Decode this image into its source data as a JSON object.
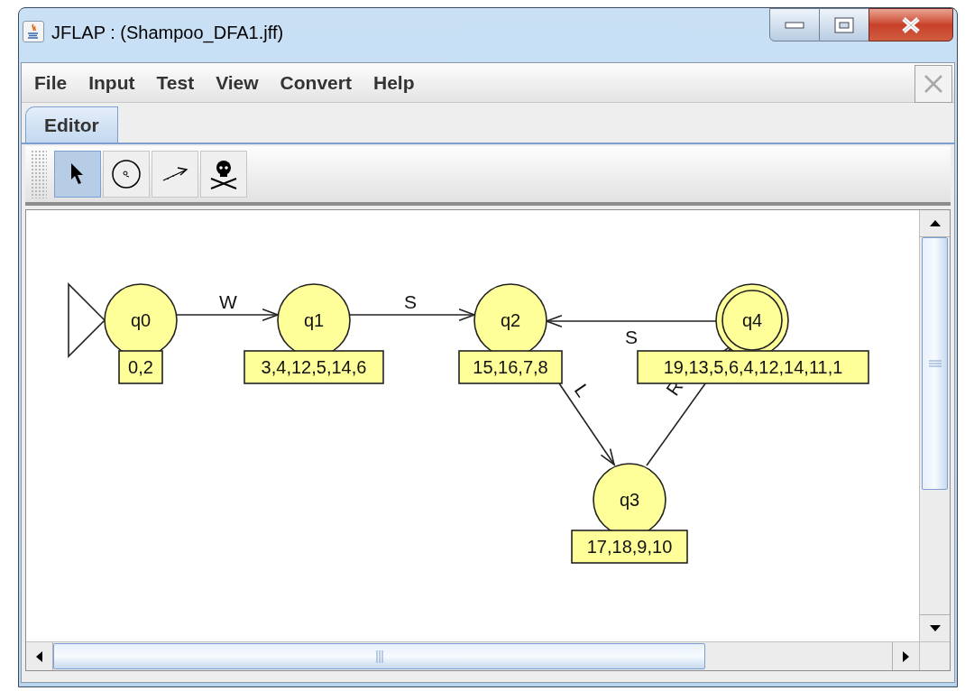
{
  "window": {
    "title": "JFLAP : (Shampoo_DFA1.jff)"
  },
  "menu": [
    "File",
    "Input",
    "Test",
    "View",
    "Convert",
    "Help"
  ],
  "tabs": [
    {
      "label": "Editor",
      "selected": true
    }
  ],
  "tools": [
    {
      "kind": "select",
      "selected": true
    },
    {
      "kind": "state",
      "selected": false
    },
    {
      "kind": "transition",
      "selected": false
    },
    {
      "kind": "delete",
      "selected": false
    }
  ],
  "states": [
    {
      "name": "q0",
      "note": "0,2",
      "initial": true,
      "final": false
    },
    {
      "name": "q1",
      "note": "3,4,12,5,14,6",
      "initial": false,
      "final": false
    },
    {
      "name": "q2",
      "note": "15,16,7,8",
      "initial": false,
      "final": false
    },
    {
      "name": "q3",
      "note": "17,18,9,10",
      "initial": false,
      "final": false
    },
    {
      "name": "q4",
      "note": "19,13,5,6,4,12,14,11,1",
      "initial": false,
      "final": true
    }
  ],
  "transitions": [
    {
      "symbol": "W"
    },
    {
      "symbol": "S"
    },
    {
      "symbol": "L"
    },
    {
      "symbol": "R"
    },
    {
      "symbol": "S"
    }
  ]
}
